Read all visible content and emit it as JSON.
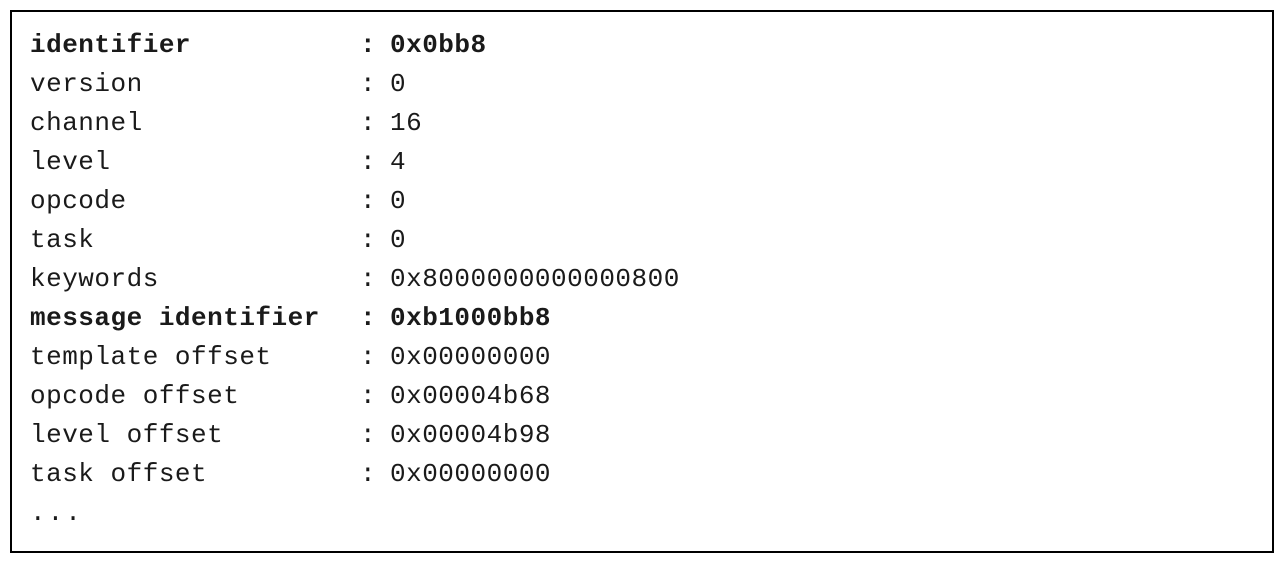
{
  "rows": [
    {
      "label": "identifier",
      "value": "0x0bb8",
      "bold": true
    },
    {
      "label": "version",
      "value": "0",
      "bold": false
    },
    {
      "label": "channel",
      "value": "16",
      "bold": false
    },
    {
      "label": "level",
      "value": "4",
      "bold": false
    },
    {
      "label": "opcode",
      "value": "0",
      "bold": false
    },
    {
      "label": "task",
      "value": "0",
      "bold": false
    },
    {
      "label": "keywords",
      "value": "0x8000000000000800",
      "bold": false
    },
    {
      "label": "message identifier",
      "value": "0xb1000bb8",
      "bold": true
    },
    {
      "label": "template offset",
      "value": "0x00000000",
      "bold": false
    },
    {
      "label": "opcode offset",
      "value": "0x00004b68",
      "bold": false
    },
    {
      "label": "level offset",
      "value": "0x00004b98",
      "bold": false
    },
    {
      "label": "task offset",
      "value": "0x00000000",
      "bold": false
    }
  ],
  "ellipsis": "..."
}
